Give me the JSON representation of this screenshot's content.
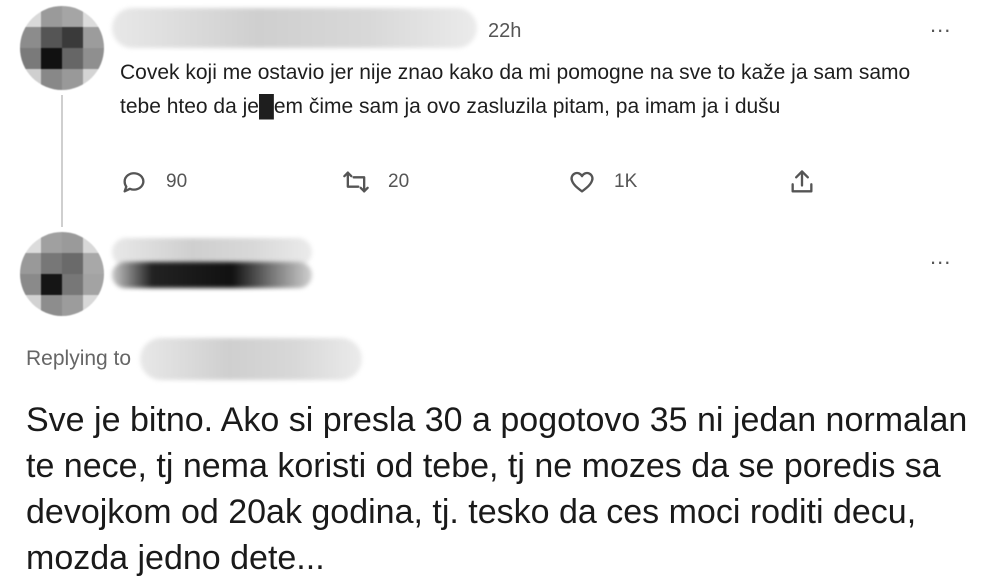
{
  "tweet1": {
    "time": "22h",
    "more_label": "...",
    "text": "Covek koji me ostavio jer nije znao kako da mi pomogne na sve to kaže ja sam samo tebe hteo da je█em čime sam ja ovo zasluzila pitam, pa imam ja i dušu",
    "stats": {
      "replies": "90",
      "retweets": "20",
      "likes": "1K"
    }
  },
  "tweet2": {
    "more_label": "...",
    "replying_label": "Replying to",
    "text": "Sve je bitno. Ako si presla 30 a pogotovo 35 ni jedan normalan te nece, tj nema koristi od tebe, tj ne mozes da se poredis sa devojkom od 20ak godina, tj. tesko da ces moci roditi decu, mozda jedno dete..."
  },
  "icons": [
    "reply-icon",
    "retweet-icon",
    "like-icon",
    "share-icon",
    "more-icon"
  ],
  "colors": {
    "text": "#1a1a1a",
    "muted": "#555555",
    "line": "#cfcfcf"
  }
}
